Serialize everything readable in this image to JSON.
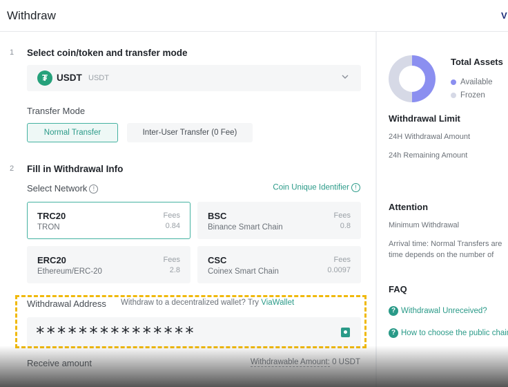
{
  "header": {
    "title": "Withdraw",
    "corner_logo": "V"
  },
  "step1": {
    "number": "1",
    "title": "Select coin/token and transfer mode"
  },
  "coin": {
    "icon": "tether-icon",
    "symbol": "USDT",
    "sub": "USDT"
  },
  "transfer_mode": {
    "label": "Transfer Mode",
    "options": [
      {
        "label": "Normal Transfer",
        "selected": true
      },
      {
        "label": "Inter-User Transfer (0 Fee)",
        "selected": false
      }
    ]
  },
  "step2": {
    "number": "2",
    "title": "Fill in Withdrawal Info"
  },
  "network": {
    "label": "Select Network",
    "coin_id_link": "Coin Unique Identifier",
    "fees_label": "Fees",
    "options": [
      {
        "name": "TRC20",
        "desc": "TRON",
        "fee": "0.84",
        "selected": true
      },
      {
        "name": "BSC",
        "desc": "Binance Smart Chain",
        "fee": "0.8",
        "selected": false
      },
      {
        "name": "ERC20",
        "desc": "Ethereum/ERC-20",
        "fee": "2.8",
        "selected": false
      },
      {
        "name": "CSC",
        "desc": "Coinex Smart Chain",
        "fee": "0.0097",
        "selected": false
      }
    ]
  },
  "address": {
    "label": "Withdrawal Address",
    "hint": "Withdraw to a decentralized wallet? Try",
    "hint_link": "ViaWallet",
    "value": "***************"
  },
  "receive": {
    "label": "Receive amount",
    "withdrawable_label": "Withdrawable Amount:",
    "withdrawable_value": "0 USDT"
  },
  "side": {
    "total_assets": "Total Assets",
    "legend": [
      {
        "label": "Available",
        "color": "#8b8ff0"
      },
      {
        "label": "Frozen",
        "color": "#d6d9e6"
      }
    ],
    "withdrawal_limit": {
      "title": "Withdrawal Limit",
      "amount_24h": "24H Withdrawal Amount",
      "remaining_24h": "24h Remaining Amount"
    },
    "attention": {
      "title": "Attention",
      "min_withdrawal": "Minimum Withdrawal",
      "arrival_line1": "Arrival time: Normal Transfers are",
      "arrival_line2": "time depends on the number of"
    },
    "faq": {
      "title": "FAQ",
      "items": [
        "Withdrawal Unreceived?",
        "How to choose the public chain"
      ]
    }
  }
}
